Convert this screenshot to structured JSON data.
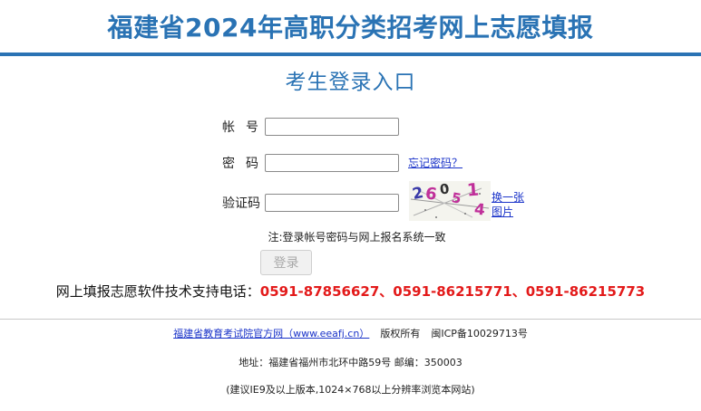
{
  "header": {
    "title": "福建省2024年高职分类招考网上志愿填报",
    "accent_color": "#2a73b4"
  },
  "login": {
    "title": "考生登录入口",
    "account_label": "帐号",
    "password_label": "密码",
    "captcha_label": "验证码",
    "account_value": "",
    "password_value": "",
    "captcha_value": "",
    "forgot_password": "忘记密码？",
    "captcha_chars": [
      "2",
      "6",
      "0",
      "5",
      "1",
      "4"
    ],
    "refresh_line1": "换一张",
    "refresh_line2": "图片",
    "note": "注:登录帐号密码与网上报名系统一致",
    "submit_label": "登录"
  },
  "support": {
    "label": "网上填报志愿软件技术支持电话：",
    "phones": "0591-87856627、0591-86215771、0591-86215773",
    "phone_color": "#e31a1a"
  },
  "footer": {
    "site_link": "福建省教育考试院官方网（www.eeafj.cn）",
    "copyright": "版权所有",
    "icp": "闽ICP备10029713号",
    "address": "地址：福建省福州市北环中路59号 邮编：350003",
    "browser_tip": "(建议IE9及以上版本,1024×768以上分辨率浏览本网站)"
  }
}
